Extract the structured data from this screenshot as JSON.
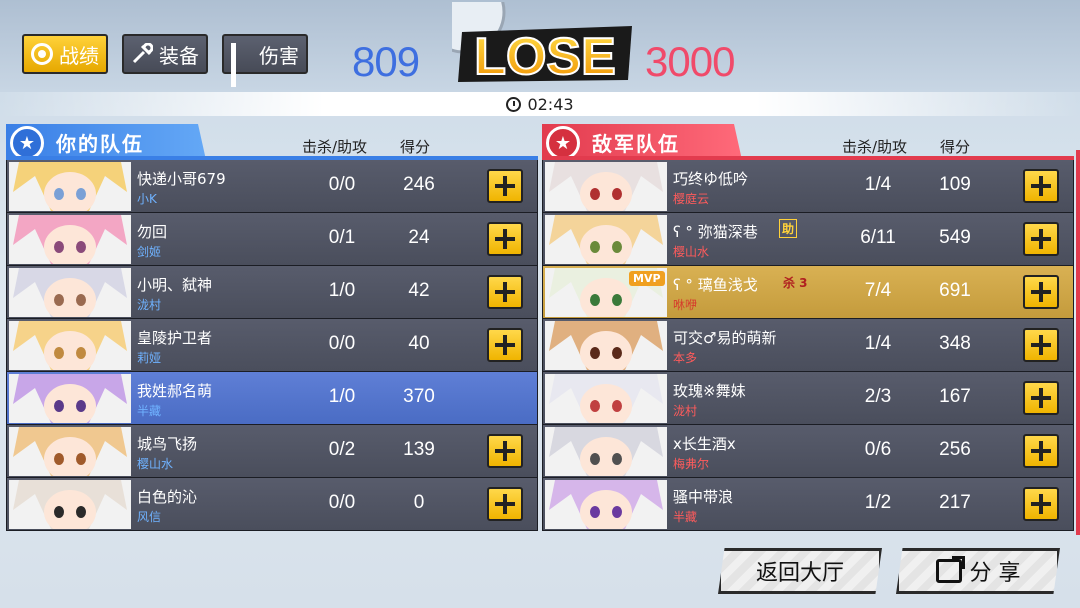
{
  "header": {
    "tabs": [
      {
        "label": "战绩",
        "icon": "record-icon",
        "active": true
      },
      {
        "label": "装备",
        "icon": "equipment-icon",
        "active": false
      },
      {
        "label": "伤害",
        "icon": "bar-chart-icon",
        "active": false
      }
    ],
    "result": "LOSE",
    "score_left": "809",
    "score_right": "3000",
    "time": "02:43"
  },
  "colors": {
    "accent": "#f0b400",
    "ally": "#3a7fe6",
    "enemy": "#e23b4e"
  },
  "ally": {
    "title": "你的队伍",
    "col_kd": "击杀/助攻",
    "col_score": "得分",
    "players": [
      {
        "name": "快递小哥679",
        "hero": "小K",
        "kd": "0/0",
        "score": "246",
        "plus": true
      },
      {
        "name": "勿回",
        "hero": "剑姬",
        "kd": "0/1",
        "score": "24",
        "plus": true
      },
      {
        "name": "小明、弑神",
        "hero": "泷村",
        "kd": "1/0",
        "score": "42",
        "plus": true
      },
      {
        "name": "皇陵护卫者",
        "hero": "莉娅",
        "kd": "0/0",
        "score": "40",
        "plus": true
      },
      {
        "name": "我姓郝名萌",
        "hero": "半藏",
        "kd": "1/0",
        "score": "370",
        "plus": false,
        "self": true
      },
      {
        "name": "城鸟飞扬",
        "hero": "樱山水",
        "kd": "0/2",
        "score": "139",
        "plus": true
      },
      {
        "name": "白色的沁",
        "hero": "风信",
        "kd": "0/0",
        "score": "0",
        "plus": true
      }
    ]
  },
  "enemy": {
    "title": "敌军队伍",
    "col_kd": "击杀/助攻",
    "col_score": "得分",
    "players": [
      {
        "name": "巧终ゆ低吟",
        "hero": "樱庭云",
        "kd": "1/4",
        "score": "109"
      },
      {
        "name": "ʕ ° 弥猫深巷",
        "hero": "樱山水",
        "kd": "6/11",
        "score": "549",
        "badge": "助"
      },
      {
        "name": "ʕ ° 璃鱼浅戈",
        "hero": "咻咿",
        "kd": "7/4",
        "score": "691",
        "mvp": "MVP",
        "badge": "杀 3"
      },
      {
        "name": "可交♂易的萌新",
        "hero": "本多",
        "kd": "1/4",
        "score": "348"
      },
      {
        "name": "玫瑰※舞妹",
        "hero": "泷村",
        "kd": "2/3",
        "score": "167"
      },
      {
        "name": "x长生酒x",
        "hero": "梅弗尔",
        "kd": "0/6",
        "score": "256"
      },
      {
        "name": "骚中带浪",
        "hero": "半藏",
        "kd": "1/2",
        "score": "217"
      }
    ]
  },
  "footer": {
    "back_label": "返回大厅",
    "share_label": "分 享"
  }
}
